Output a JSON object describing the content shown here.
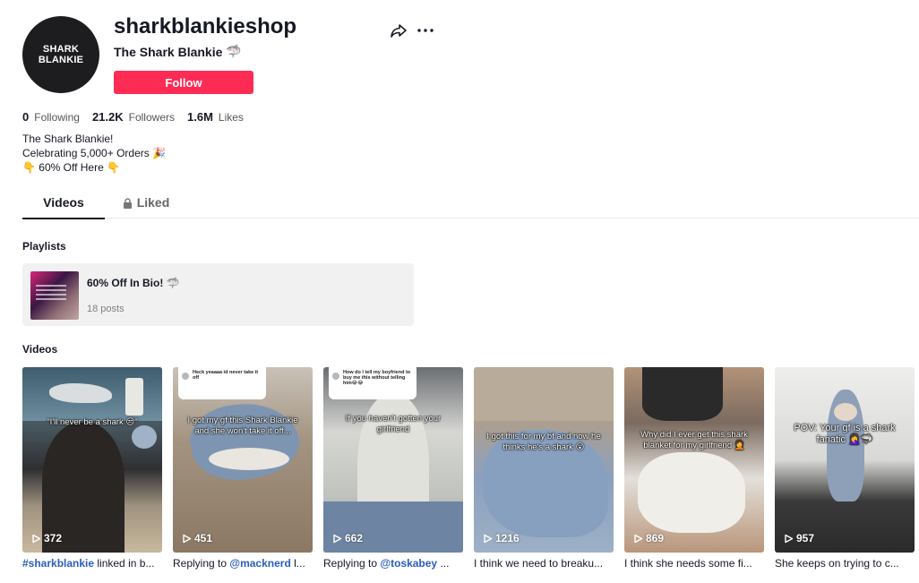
{
  "profile": {
    "username": "sharkblankieshop",
    "nickname": "The Shark Blankie",
    "nickname_emoji": "🦈",
    "avatar_line1": "SHARK",
    "avatar_line2": "BLANKIE",
    "follow_label": "Follow"
  },
  "stats": [
    {
      "value": "0",
      "label": "Following"
    },
    {
      "value": "21.2K",
      "label": "Followers"
    },
    {
      "value": "1.6M",
      "label": "Likes"
    }
  ],
  "bio": {
    "line1": "The Shark Blankie!",
    "line2": "Celebrating 5,000+ Orders 🎉",
    "line3": "👇 60% Off Here 👇"
  },
  "tabs": [
    {
      "label": "Videos",
      "active": true
    },
    {
      "label": "Liked",
      "active": false,
      "icon": "lock-icon"
    }
  ],
  "playlists": {
    "title": "Playlists",
    "items": [
      {
        "title": "60% Off In Bio! 🦈",
        "count": "18 posts"
      }
    ]
  },
  "videos_section": {
    "title": "Videos",
    "items": [
      {
        "views": "372",
        "caption": "\"I'll never be a shark 😒\"",
        "desc_link": "#sharkblankie",
        "desc_text": " linked in b..."
      },
      {
        "views": "451",
        "bubble": "Heck yeaaaa id never take it off",
        "caption": "I got my gf this Shark Blankie and she won't take it off...",
        "desc_prefix": "Replying to ",
        "desc_link": "@macknerd",
        "desc_text": " l..."
      },
      {
        "views": "662",
        "bubble": "How do I tell my boyfriend to buy me this without telling him😂😂",
        "caption": "If you haven't gotten your girlfriend",
        "desc_prefix": "Replying to ",
        "desc_link": "@toskabey",
        "desc_text": " ..."
      },
      {
        "views": "1216",
        "caption": "I got this for my bf and now he thinks he's a shark 😮",
        "desc_text": "I think we need to breaku..."
      },
      {
        "views": "869",
        "caption": "Why did I ever get this shark blanket for my girlfriend 🤦",
        "desc_text": "I think she needs some fi..."
      },
      {
        "views": "957",
        "caption": "POV: Your gf is a shark fanatic 🤦‍♀️🦈",
        "desc_text": "She keeps on trying to c..."
      }
    ]
  },
  "colors": {
    "accent": "#fe2c55",
    "link": "#2b5db9"
  }
}
